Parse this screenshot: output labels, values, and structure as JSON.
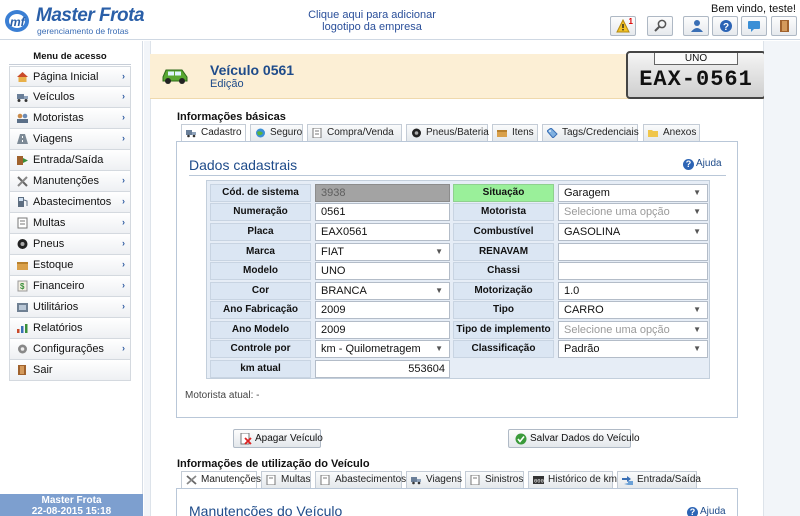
{
  "header": {
    "brand": "Master Frota",
    "tagline": "gerenciamento de frotas",
    "logo_link": "Clique aqui para adicionar logotipo da empresa",
    "welcome": "Bem vindo, teste!",
    "alerts_count": "1",
    "toolbar_icons": [
      "alert-icon",
      "search-icon",
      "user-icon",
      "help-icon",
      "chat-icon",
      "exit-icon"
    ]
  },
  "sidebar": {
    "title": "Menu de acesso",
    "items": [
      {
        "label": "Página Inicial",
        "icon": "home-icon",
        "has_submenu": true
      },
      {
        "label": "Veículos",
        "icon": "truck-icon",
        "has_submenu": true
      },
      {
        "label": "Motoristas",
        "icon": "drivers-icon",
        "has_submenu": true
      },
      {
        "label": "Viagens",
        "icon": "road-icon",
        "has_submenu": true
      },
      {
        "label": "Entrada/Saída",
        "icon": "inout-icon",
        "has_submenu": false
      },
      {
        "label": "Manutenções",
        "icon": "wrench-icon",
        "has_submenu": true
      },
      {
        "label": "Abastecimentos",
        "icon": "fuel-icon",
        "has_submenu": true
      },
      {
        "label": "Multas",
        "icon": "ticket-icon",
        "has_submenu": true
      },
      {
        "label": "Pneus",
        "icon": "tire-icon",
        "has_submenu": true
      },
      {
        "label": "Estoque",
        "icon": "box-icon",
        "has_submenu": true
      },
      {
        "label": "Financeiro",
        "icon": "money-icon",
        "has_submenu": true
      },
      {
        "label": "Utilitários",
        "icon": "tools-icon",
        "has_submenu": true
      },
      {
        "label": "Relatórios",
        "icon": "report-icon",
        "has_submenu": false
      },
      {
        "label": "Configurações",
        "icon": "gear-icon",
        "has_submenu": true
      },
      {
        "label": "Sair",
        "icon": "exit-icon",
        "has_submenu": false
      }
    ],
    "footer_app": "Master Frota",
    "footer_datetime": "22-08-2015 15:18"
  },
  "page": {
    "title": "Veículo 0561",
    "subtitle": "Edição",
    "plate_model": "UNO",
    "plate_number": "EAX-0561"
  },
  "basic_info": {
    "section_title": "Informações básicas",
    "tabs": [
      {
        "label": "Cadastro",
        "icon": "truck-icon",
        "active": true
      },
      {
        "label": "Seguro",
        "icon": "globe-icon",
        "active": false
      },
      {
        "label": "Compra/Venda",
        "icon": "doc-icon",
        "active": false
      },
      {
        "label": "Pneus/Bateria",
        "icon": "tire-icon",
        "active": false
      },
      {
        "label": "Itens",
        "icon": "box-icon",
        "active": false
      },
      {
        "label": "Tags/Credenciais",
        "icon": "tag-icon",
        "active": false
      },
      {
        "label": "Anexos",
        "icon": "folder-icon",
        "active": false
      }
    ],
    "panel_title": "Dados cadastrais",
    "help_label": "Ajuda",
    "fields": {
      "cod_sistema": {
        "label": "Cód. de sistema",
        "value": "3938"
      },
      "numeracao": {
        "label": "Numeração",
        "value": "0561"
      },
      "placa": {
        "label": "Placa",
        "value": "EAX0561"
      },
      "marca": {
        "label": "Marca",
        "value": "FIAT"
      },
      "modelo": {
        "label": "Modelo",
        "value": "UNO"
      },
      "cor": {
        "label": "Cor",
        "value": "BRANCA"
      },
      "ano_fabricacao": {
        "label": "Ano Fabricação",
        "value": "2009"
      },
      "ano_modelo": {
        "label": "Ano Modelo",
        "value": "2009"
      },
      "controle_por": {
        "label": "Controle por",
        "value": "km - Quilometragem"
      },
      "km_atual": {
        "label": "km atual",
        "value": "553604"
      },
      "situacao": {
        "label": "Situação",
        "value": "Garagem"
      },
      "motorista": {
        "label": "Motorista",
        "placeholder": "Selecione uma opção"
      },
      "combustivel": {
        "label": "Combustível",
        "value": "GASOLINA"
      },
      "renavam": {
        "label": "RENAVAM",
        "value": ""
      },
      "chassi": {
        "label": "Chassi",
        "value": ""
      },
      "motorizacao": {
        "label": "Motorização",
        "value": "1.0"
      },
      "tipo": {
        "label": "Tipo",
        "value": "CARRO"
      },
      "tipo_implemento": {
        "label": "Tipo de implemento",
        "placeholder": "Selecione uma opção"
      },
      "classificacao": {
        "label": "Classificação",
        "value": "Padrão"
      }
    },
    "motorista_atual": "Motorista atual: -"
  },
  "actions": {
    "delete_label": "Apagar Veículo",
    "save_label": "Salvar Dados do Veículo"
  },
  "usage_info": {
    "section_title": "Informações de utilização do Veículo",
    "tabs": [
      {
        "label": "Manutenções",
        "icon": "wrench-icon",
        "active": true
      },
      {
        "label": "Multas",
        "icon": "doc-icon",
        "active": false
      },
      {
        "label": "Abastecimentos",
        "icon": "doc-icon",
        "active": false
      },
      {
        "label": "Viagens",
        "icon": "truck-icon",
        "active": false
      },
      {
        "label": "Sinistros",
        "icon": "doc-icon",
        "active": false
      },
      {
        "label": "Histórico de km",
        "icon": "odometer-icon",
        "active": false
      },
      {
        "label": "Entrada/Saída",
        "icon": "inout-icon",
        "active": false
      }
    ],
    "panel_title": "Manutenções do Veículo",
    "help_label": "Ajuda"
  },
  "colors": {
    "brand_blue": "#2a5fa8",
    "header_bg": "#fcefd5",
    "label_bg": "#dbe6f3",
    "status_green": "#9af09a",
    "sidebar_footer": "#7d9fcf"
  }
}
